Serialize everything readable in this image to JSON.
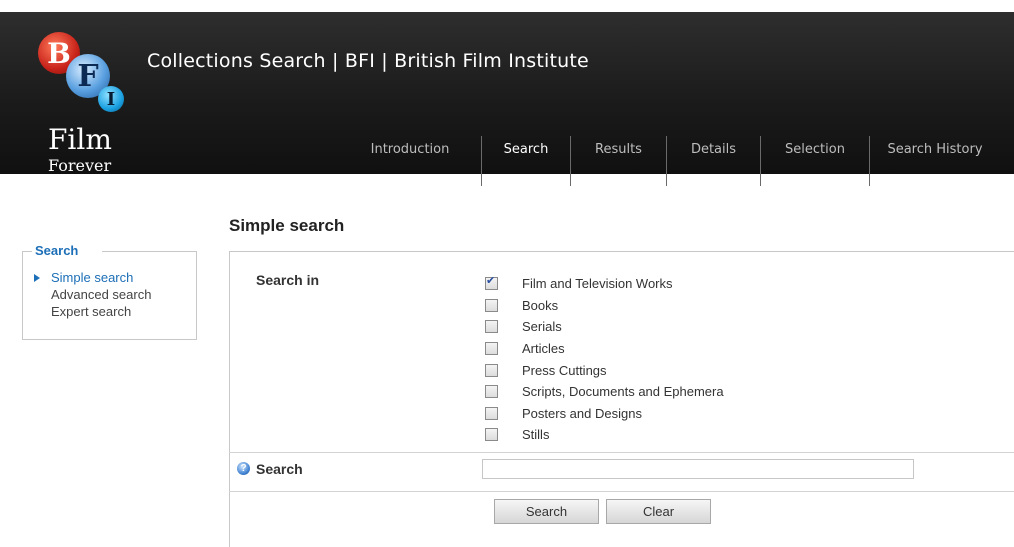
{
  "header": {
    "site_title": "Collections Search | BFI | British Film Institute",
    "logo": {
      "letters": [
        "B",
        "F",
        "I"
      ],
      "line1": "Film",
      "line2": "Forever"
    }
  },
  "nav": {
    "items": [
      {
        "label": "Introduction",
        "active": false
      },
      {
        "label": "Search",
        "active": true
      },
      {
        "label": "Results",
        "active": false
      },
      {
        "label": "Details",
        "active": false
      },
      {
        "label": "Selection",
        "active": false
      },
      {
        "label": "Search History",
        "active": false
      }
    ]
  },
  "sidebar": {
    "title": "Search",
    "links": [
      {
        "label": "Simple search",
        "active": true
      },
      {
        "label": "Advanced search",
        "active": false
      },
      {
        "label": "Expert search",
        "active": false
      }
    ]
  },
  "main": {
    "title": "Simple search",
    "search_in_label": "Search in",
    "sources": [
      {
        "label": "Film and Television Works",
        "checked": true
      },
      {
        "label": "Books",
        "checked": false
      },
      {
        "label": "Serials",
        "checked": false
      },
      {
        "label": "Articles",
        "checked": false
      },
      {
        "label": "Press Cuttings",
        "checked": false
      },
      {
        "label": "Scripts, Documents and Ephemera",
        "checked": false
      },
      {
        "label": "Posters and Designs",
        "checked": false
      },
      {
        "label": "Stills",
        "checked": false
      }
    ],
    "search_label": "Search",
    "search_value": "",
    "search_button": "Search",
    "clear_button": "Clear"
  },
  "colors": {
    "accent": "#1d6fb8",
    "header_bg": "#1b1b1b"
  }
}
